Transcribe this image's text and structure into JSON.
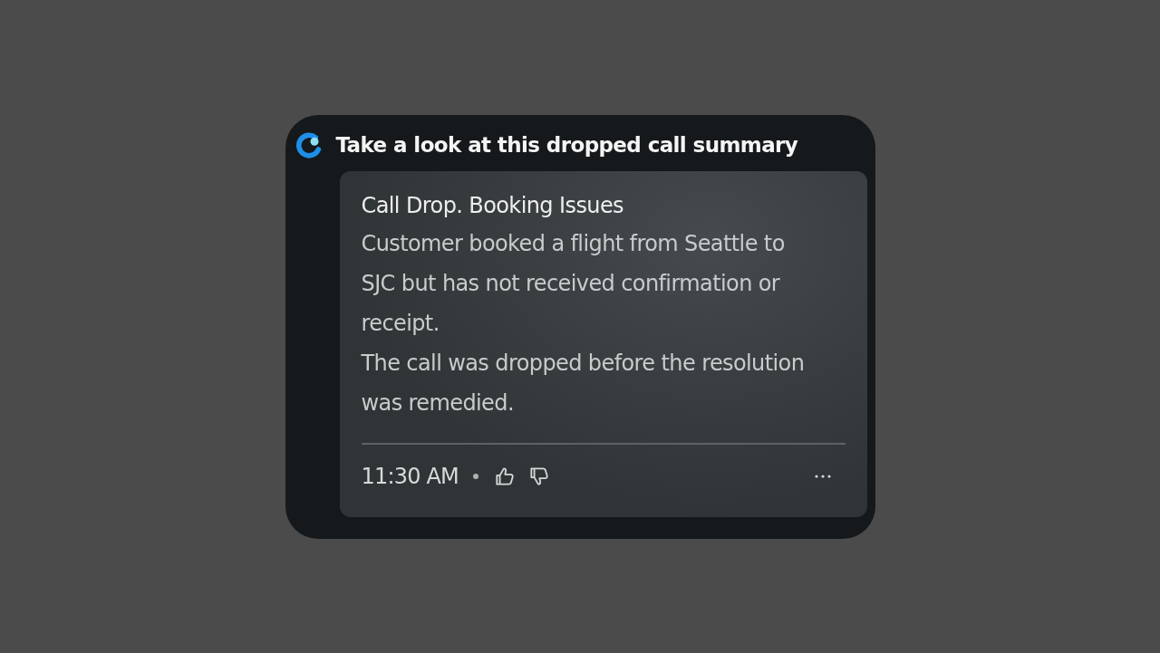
{
  "message": {
    "title": "Take a look at this dropped call summary",
    "card": {
      "heading": "Call Drop. Booking Issues",
      "paragraphs": [
        "Customer booked a flight from Seattle to SJC but has not received confirmation or receipt.",
        "The call was dropped before the resolution was remedied."
      ],
      "time": "11:30 AM"
    }
  }
}
